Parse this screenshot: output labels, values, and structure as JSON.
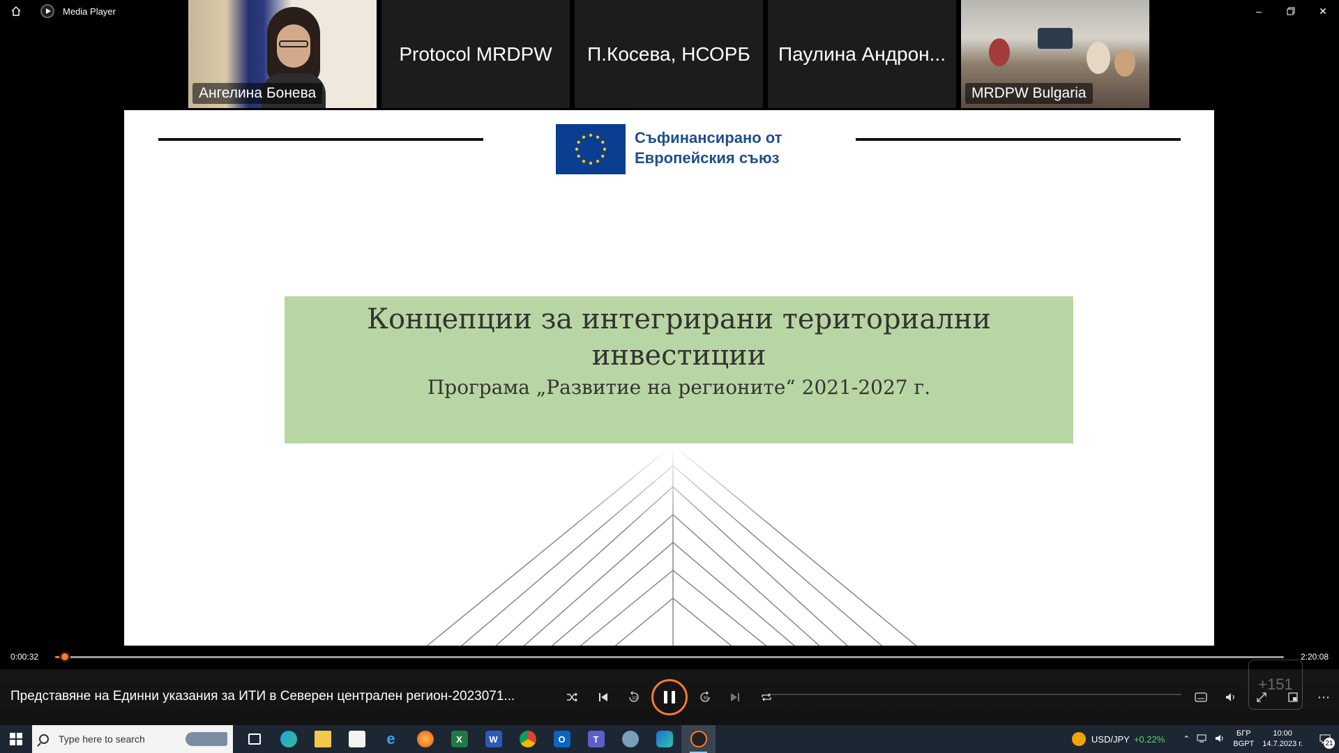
{
  "window": {
    "title": "Media Player",
    "home_icon": "home-icon",
    "controls": [
      "minimize-icon",
      "restore-icon",
      "close-icon"
    ]
  },
  "participants": [
    {
      "name": "Ангелина Бонева",
      "type": "video"
    },
    {
      "name": "Protocol MRDPW",
      "type": "name"
    },
    {
      "name": "П.Косева, НСОРБ",
      "type": "name"
    },
    {
      "name": "Паулина Андрон...",
      "type": "name"
    },
    {
      "name": "MRDPW Bulgaria",
      "type": "video"
    }
  ],
  "slide": {
    "eu_text_line1": "Съфинансирано от",
    "eu_text_line2": "Европейския съюз",
    "title": "Концепции за интегрирани териториални инвестиции",
    "subtitle": "Програма „Развитие на регионите“ 2021-2027 г.",
    "banner_color": "#b8d6a3"
  },
  "player": {
    "elapsed": "0:00:32",
    "duration": "2:20:08",
    "progress": 0.004,
    "media_title": "Представяне на Единни указания за ИТИ в Северен централен регион-2023071...",
    "overlay_count": "+151",
    "accent": "#ff7a30"
  },
  "taskbar": {
    "search_placeholder": "Type here to search",
    "apps": [
      {
        "icon": "task-view-icon"
      },
      {
        "icon": "edge-icon"
      },
      {
        "icon": "file-explorer-icon"
      },
      {
        "icon": "store-icon"
      },
      {
        "icon": "ie-icon"
      },
      {
        "icon": "firefox-icon"
      },
      {
        "icon": "excel-icon"
      },
      {
        "icon": "word-icon"
      },
      {
        "icon": "chrome-icon"
      },
      {
        "icon": "outlook-icon"
      },
      {
        "icon": "teams-icon"
      },
      {
        "icon": "app-icon"
      },
      {
        "icon": "webex-icon"
      },
      {
        "icon": "media-player-icon"
      }
    ],
    "ticker_name": "USD/JPY",
    "ticker_change": "+0.22%",
    "lang_top": "БГР",
    "lang_bottom": "BGPT",
    "time": "10:00",
    "date": "14.7.2023 г.",
    "notifications": "21"
  }
}
